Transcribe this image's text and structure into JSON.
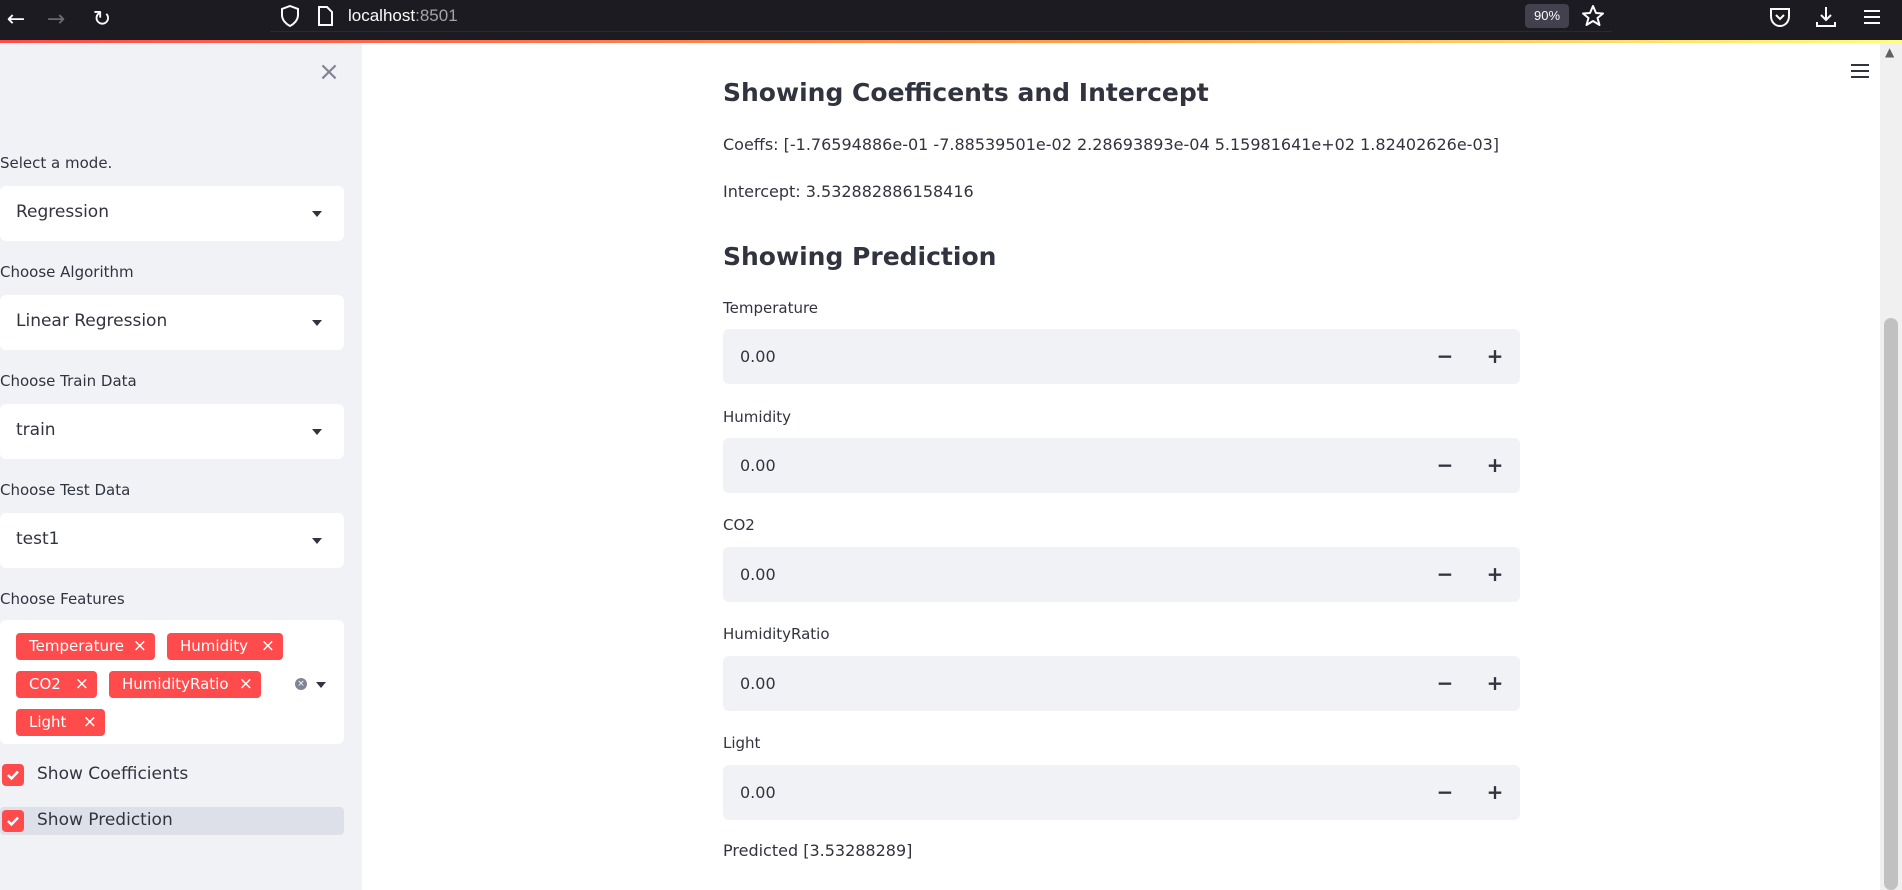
{
  "browser": {
    "url_host": "localhost",
    "url_port": ":8501",
    "zoom": "90%"
  },
  "sidebar": {
    "mode_label": "Select a mode.",
    "mode_value": "Regression",
    "algorithm_label": "Choose Algorithm",
    "algorithm_value": "Linear Regression",
    "train_label": "Choose Train Data",
    "train_value": "train",
    "test_label": "Choose Test Data",
    "test_value": "test1",
    "features_label": "Choose Features",
    "features": [
      "Temperature",
      "Humidity",
      "CO2",
      "HumidityRatio",
      "Light"
    ],
    "show_coefficients_label": "Show Coefficients",
    "show_coefficients_checked": true,
    "show_prediction_label": "Show Prediction",
    "show_prediction_checked": true
  },
  "main": {
    "coeff_heading": "Showing Coefficents and Intercept",
    "coeffs_text": "Coeffs: [-1.76594886e-01 -7.88539501e-02 2.28693893e-04 5.15981641e+02 1.82402626e-03]",
    "intercept_text": "Intercept: 3.532882886158416",
    "prediction_heading": "Showing Prediction",
    "inputs": [
      {
        "label": "Temperature",
        "value": "0.00"
      },
      {
        "label": "Humidity",
        "value": "0.00"
      },
      {
        "label": "CO2",
        "value": "0.00"
      },
      {
        "label": "HumidityRatio",
        "value": "0.00"
      },
      {
        "label": "Light",
        "value": "0.00"
      }
    ],
    "stepper_minus": "−",
    "stepper_plus": "+",
    "predicted_text": "Predicted [3.53288289]"
  },
  "colors": {
    "accent": "#ff4b4b",
    "sidebar_bg": "#f0f2f6",
    "text": "#31333f"
  }
}
